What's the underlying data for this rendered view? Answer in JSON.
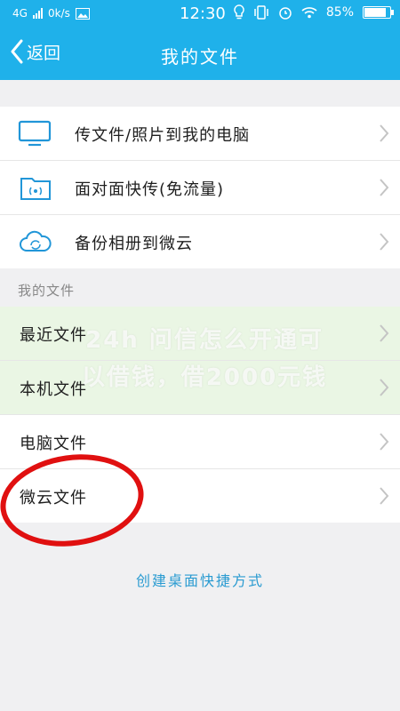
{
  "status_bar": {
    "network": "4G",
    "speed": "0k/s",
    "time": "12:30",
    "battery": "85%"
  },
  "nav": {
    "back_label": "返回",
    "title": "我的文件"
  },
  "top_list": [
    {
      "label": "传文件/照片到我的电脑",
      "icon": "computer-icon"
    },
    {
      "label": "面对面快传(免流量)",
      "icon": "wifi-folder-icon"
    },
    {
      "label": "备份相册到微云",
      "icon": "cloud-sync-icon"
    }
  ],
  "section": {
    "title": "我的文件",
    "items": [
      {
        "label": "最近文件"
      },
      {
        "label": "本机文件"
      },
      {
        "label": "电脑文件"
      },
      {
        "label": "微云文件"
      }
    ]
  },
  "watermark": {
    "line1": "24h 问信怎么开通可",
    "line2": "以借钱，借2000元钱"
  },
  "footer": {
    "shortcut_label": "创建桌面快捷方式"
  },
  "colors": {
    "accent": "#1fb1ea",
    "icon_blue": "#2196d8",
    "link_blue": "#2a9bd1",
    "circle_red": "#e01010",
    "highlight_green": "#eaf6e4"
  }
}
